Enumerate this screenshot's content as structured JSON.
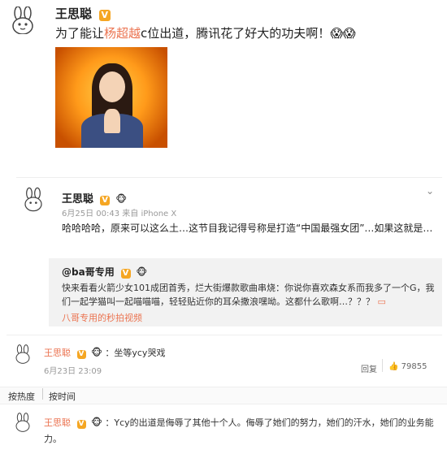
{
  "post": {
    "author": "王思聪",
    "text_before_link": "为了能让",
    "link_text": "杨超越",
    "text_after_link": "c位出道，腾讯花了好大的功夫啊！",
    "trailing_emoji": "😱😱"
  },
  "forward1": {
    "author": "王思聪",
    "meta": "6月25日 00:43 来自 iPhone X",
    "text": "哈哈哈哈，原来可以这么土…这节目我记得号称是打造“中国最强女团”…如果这就是…",
    "quoted_author": "@ba哥专用",
    "quoted_text": "快来看看火箭少女101成团首秀，烂大街爆款歌曲串烧：你说你喜欢森女系而我多了一个G，我们一起学猫叫一起喵喵喵，轻轻贴近你的耳朵撒浪嘿呦。这都什么歌啊…？？？",
    "video_label": "八哥专用的秒拍视频"
  },
  "comment1": {
    "author": "王思聪",
    "text": "：坐等ycy哭戏",
    "time": "6月23日 23:09",
    "reply_label": "回复",
    "like_count": "79855"
  },
  "sort": {
    "hot": "按热度",
    "time": "按时间"
  },
  "comment2": {
    "author": "王思聪",
    "text": "：Ycy的出道是侮辱了其他十个人。侮辱了她们的努力，她们的汗水，她们的业务能力。"
  },
  "icons": {
    "avatar": "rabbit-avatar",
    "badge": "v-verified-badge",
    "chevron": "chevron-down-icon",
    "like": "thumb-up-icon"
  },
  "colors": {
    "link": "#eb7350",
    "badge": "#f5a623"
  }
}
